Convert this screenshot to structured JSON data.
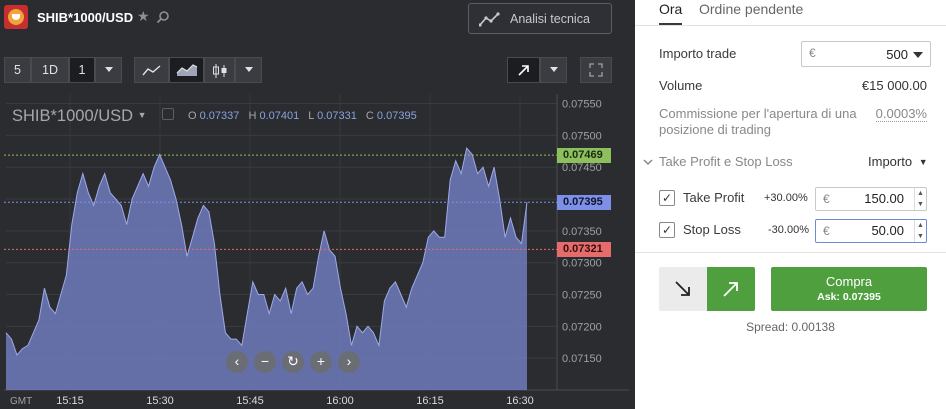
{
  "header": {
    "asset": "SHIB*1000/USD",
    "analysis_label": "Analisi tecnica"
  },
  "toolbar": {
    "count": "5",
    "period": "1D",
    "interval": "1"
  },
  "chart": {
    "pair_label": "SHIB*1000/USD",
    "ohlc": {
      "o_label": "O",
      "o": "0.07337",
      "h_label": "H",
      "h": "0.07401",
      "l_label": "L",
      "l": "0.07331",
      "c_label": "C",
      "c": "0.07395"
    },
    "tags": {
      "upper": "0.07469",
      "current": "0.07395",
      "lower": "0.07321"
    },
    "gmt": "GMT",
    "colors": {
      "area": "#6e7bbd",
      "upper": "#8cc05c",
      "current": "#7d8fe6",
      "lower": "#e86b6b"
    }
  },
  "chart_data": {
    "type": "area",
    "y_ticks": [
      "0.07550",
      "0.07500",
      "0.07450",
      "0.07400",
      "0.07350",
      "0.07300",
      "0.07250",
      "0.07200",
      "0.07150"
    ],
    "x_ticks": [
      "15:15",
      "15:30",
      "15:45",
      "16:00",
      "16:15",
      "16:30"
    ],
    "ylim": [
      0.071,
      0.07565
    ],
    "grid": true,
    "series": [
      {
        "values": [
          0.0719,
          0.0718,
          0.07155,
          0.07165,
          0.0717,
          0.0719,
          0.0721,
          0.0726,
          0.0723,
          0.0722,
          0.0725,
          0.0728,
          0.0736,
          0.0741,
          0.0744,
          0.0741,
          0.0739,
          0.0742,
          0.0744,
          0.0741,
          0.074,
          0.0739,
          0.0736,
          0.074,
          0.0742,
          0.0744,
          0.0742,
          0.0745,
          0.0747,
          0.0745,
          0.0743,
          0.074,
          0.0736,
          0.0731,
          0.0734,
          0.0737,
          0.0739,
          0.0738,
          0.0733,
          0.0725,
          0.0719,
          0.0718,
          0.0718,
          0.0717,
          0.0722,
          0.0727,
          0.0725,
          0.0725,
          0.0722,
          0.0725,
          0.0724,
          0.0726,
          0.0722,
          0.0726,
          0.0727,
          0.0725,
          0.0726,
          0.0731,
          0.0735,
          0.0732,
          0.0731,
          0.0726,
          0.0722,
          0.0717,
          0.072,
          0.0719,
          0.072,
          0.0719,
          0.0717,
          0.0724,
          0.0726,
          0.0727,
          0.0725,
          0.0723,
          0.0726,
          0.0728,
          0.073,
          0.0734,
          0.0735,
          0.0734,
          0.0734,
          0.0743,
          0.0746,
          0.0744,
          0.0748,
          0.0747,
          0.0744,
          0.0745,
          0.0742,
          0.0745,
          0.074,
          0.0734,
          0.0737,
          0.0734,
          0.0733,
          0.07395
        ]
      }
    ]
  },
  "trade": {
    "tab_now": "Ora",
    "tab_pending": "Ordine pendente",
    "amount_label": "Importo trade",
    "currency": "€",
    "amount": "500",
    "volume_label": "Volume",
    "volume": "€15 000.00",
    "commission_label_1": "Commissione per l'apertura di una",
    "commission_label_2": "posizione di trading",
    "commission": "0.0003%",
    "tpsl_label": "Take Profit e Stop Loss",
    "tpsl_mode": "Importo",
    "tp_label": "Take Profit",
    "tp_pct": "+30.00%",
    "tp_value": "150.00",
    "sl_label": "Stop Loss",
    "sl_pct": "-30.00%",
    "sl_value": "50.00",
    "buy_label": "Compra",
    "ask": "Ask: 0.07395",
    "spread": "Spread: 0.00138",
    "colors": {
      "buy": "#4f9f3f"
    }
  }
}
